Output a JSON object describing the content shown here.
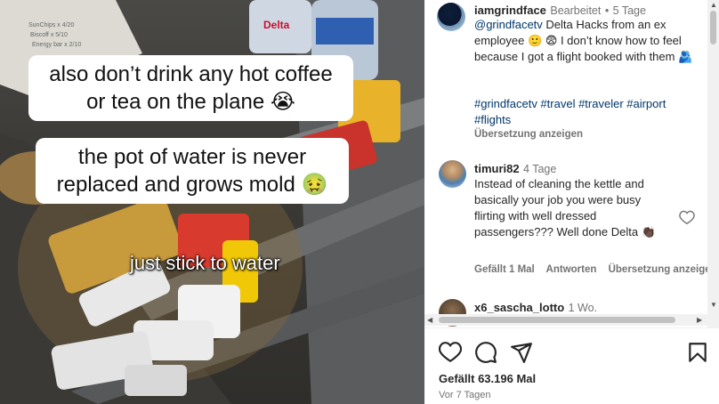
{
  "media": {
    "caption_1": "also don’t drink any hot coffee or tea on the plane 😭",
    "caption_2": "the pot of water is never replaced and grows mold 🤢",
    "caption_3": "just stick to water",
    "bottle_text": "Delta"
  },
  "post": {
    "username": "iamgrindface",
    "edited": "Bearbeitet",
    "dot": "•",
    "age": "5 Tage",
    "mention": "@grindfacetv",
    "text": "Delta Hacks from an ex employee 🙂 😨 I don’t know how to feel because I got a flight booked with them 🫂",
    "hashtags": "#grindfacetv #travel #traveler #airport #flights",
    "translate": "Übersetzung anzeigen"
  },
  "comment": {
    "username": "timuri82",
    "age": "4 Tage",
    "text": "Instead of cleaning the kettle and basically your job you were busy flirting with well dressed passengers??? Well done Delta 👏🏿",
    "emoji_line": "👏🏿",
    "likes": "Gefällt 1 Mal",
    "reply": "Antworten",
    "translate": "Übersetzung anzeige"
  },
  "comment_next": {
    "username": "x6_sascha_lotto",
    "age": "1 Wo."
  },
  "footer": {
    "likes": "Gefällt 63.196 Mal",
    "date": "Vor 7 Tagen"
  },
  "icons": [
    "heart-icon",
    "comment-icon",
    "share-icon",
    "bookmark-icon"
  ]
}
